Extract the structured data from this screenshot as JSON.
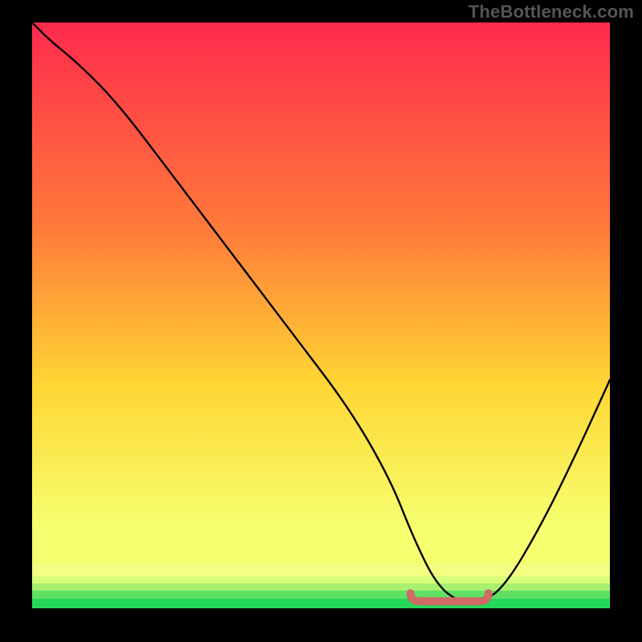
{
  "watermark": "TheBottleneck.com",
  "colors": {
    "frame": "#000000",
    "watermark": "#555555",
    "curve": "#000000",
    "marker": "#cf6a66",
    "gradient_top": "#ff2a4e",
    "gradient_mid1": "#ff7a3a",
    "gradient_mid2": "#ffd634",
    "gradient_low": "#f6ff6f",
    "gradient_green": "#25d85a"
  },
  "chart_data": {
    "type": "line",
    "title": "",
    "xlabel": "",
    "ylabel": "",
    "xlim": [
      0,
      100
    ],
    "ylim": [
      0,
      100
    ],
    "grid": false,
    "legend": null,
    "series": [
      {
        "name": "bottleneck-curve",
        "x": [
          0,
          3,
          8,
          15,
          25,
          35,
          45,
          55,
          62,
          66,
          70,
          74,
          78,
          82,
          88,
          94,
          100
        ],
        "y": [
          100,
          97,
          93,
          86,
          73,
          60,
          47,
          34,
          22,
          12,
          4,
          1,
          1,
          4,
          14,
          26,
          39
        ]
      }
    ],
    "optimal_range": {
      "x_start": 65.5,
      "x_end": 79,
      "y": 1.2
    },
    "gradient_stops_pct": [
      0,
      35,
      62,
      86,
      92,
      95,
      97,
      100
    ],
    "bottom_bands": [
      {
        "from_pct": 92.5,
        "to_pct": 94.5,
        "color": "#f3ff82"
      },
      {
        "from_pct": 94.5,
        "to_pct": 95.8,
        "color": "#d7ff7a"
      },
      {
        "from_pct": 95.8,
        "to_pct": 97.0,
        "color": "#a8f06f"
      },
      {
        "from_pct": 97.0,
        "to_pct": 98.3,
        "color": "#5fe063"
      },
      {
        "from_pct": 98.3,
        "to_pct": 100,
        "color": "#25d85a"
      }
    ]
  }
}
